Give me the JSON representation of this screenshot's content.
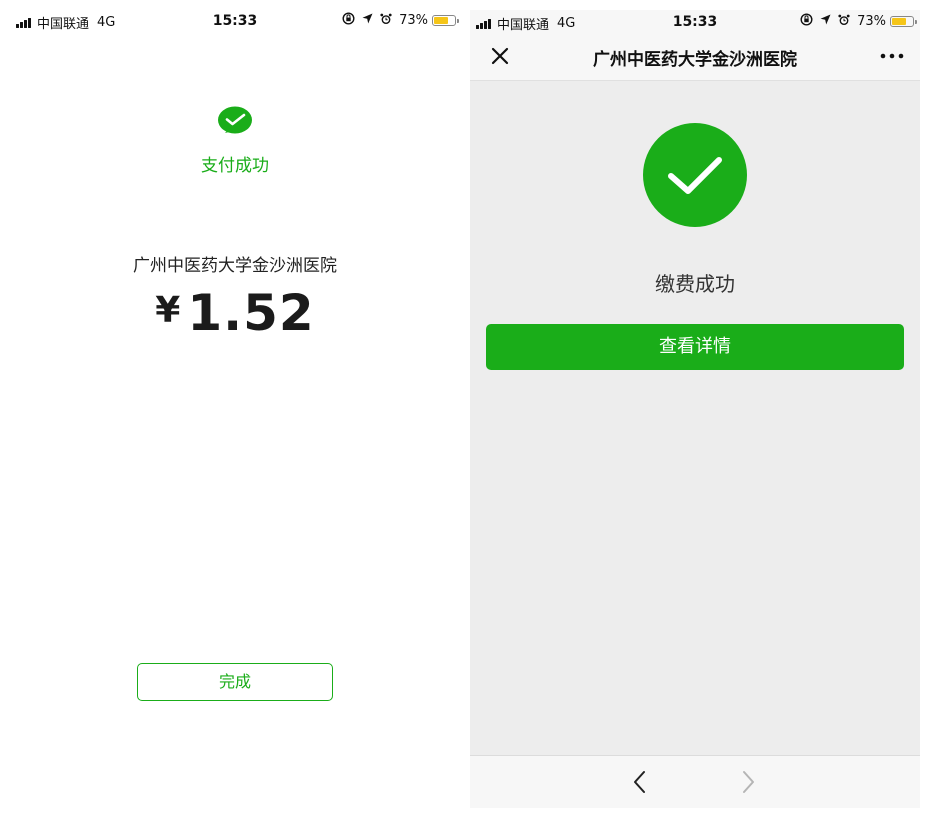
{
  "colors": {
    "accent": "#1aad19",
    "battery": "#f5c518",
    "page_bg_right": "#ededed"
  },
  "status_bar": {
    "carrier": "中国联通",
    "network": "4G",
    "time": "15:33",
    "battery_percent": "73%",
    "battery_level": 0.73,
    "icons": [
      "signal-icon",
      "orientation-lock-icon",
      "location-icon",
      "alarm-icon",
      "battery-icon"
    ]
  },
  "left_screen": {
    "logo_icon": "wechat-pay-icon",
    "status_text": "支付成功",
    "merchant": "广州中医药大学金沙洲医院",
    "currency_symbol": "¥",
    "amount": "1.52",
    "done_label": "完成"
  },
  "right_screen": {
    "close_icon": "close-icon",
    "title": "广州中医药大学金沙洲医院",
    "more_icon": "more-icon",
    "success_icon": "check-circle-icon",
    "status_text": "缴费成功",
    "details_label": "查看详情",
    "back_icon": "chevron-left-icon",
    "forward_icon": "chevron-right-icon"
  }
}
